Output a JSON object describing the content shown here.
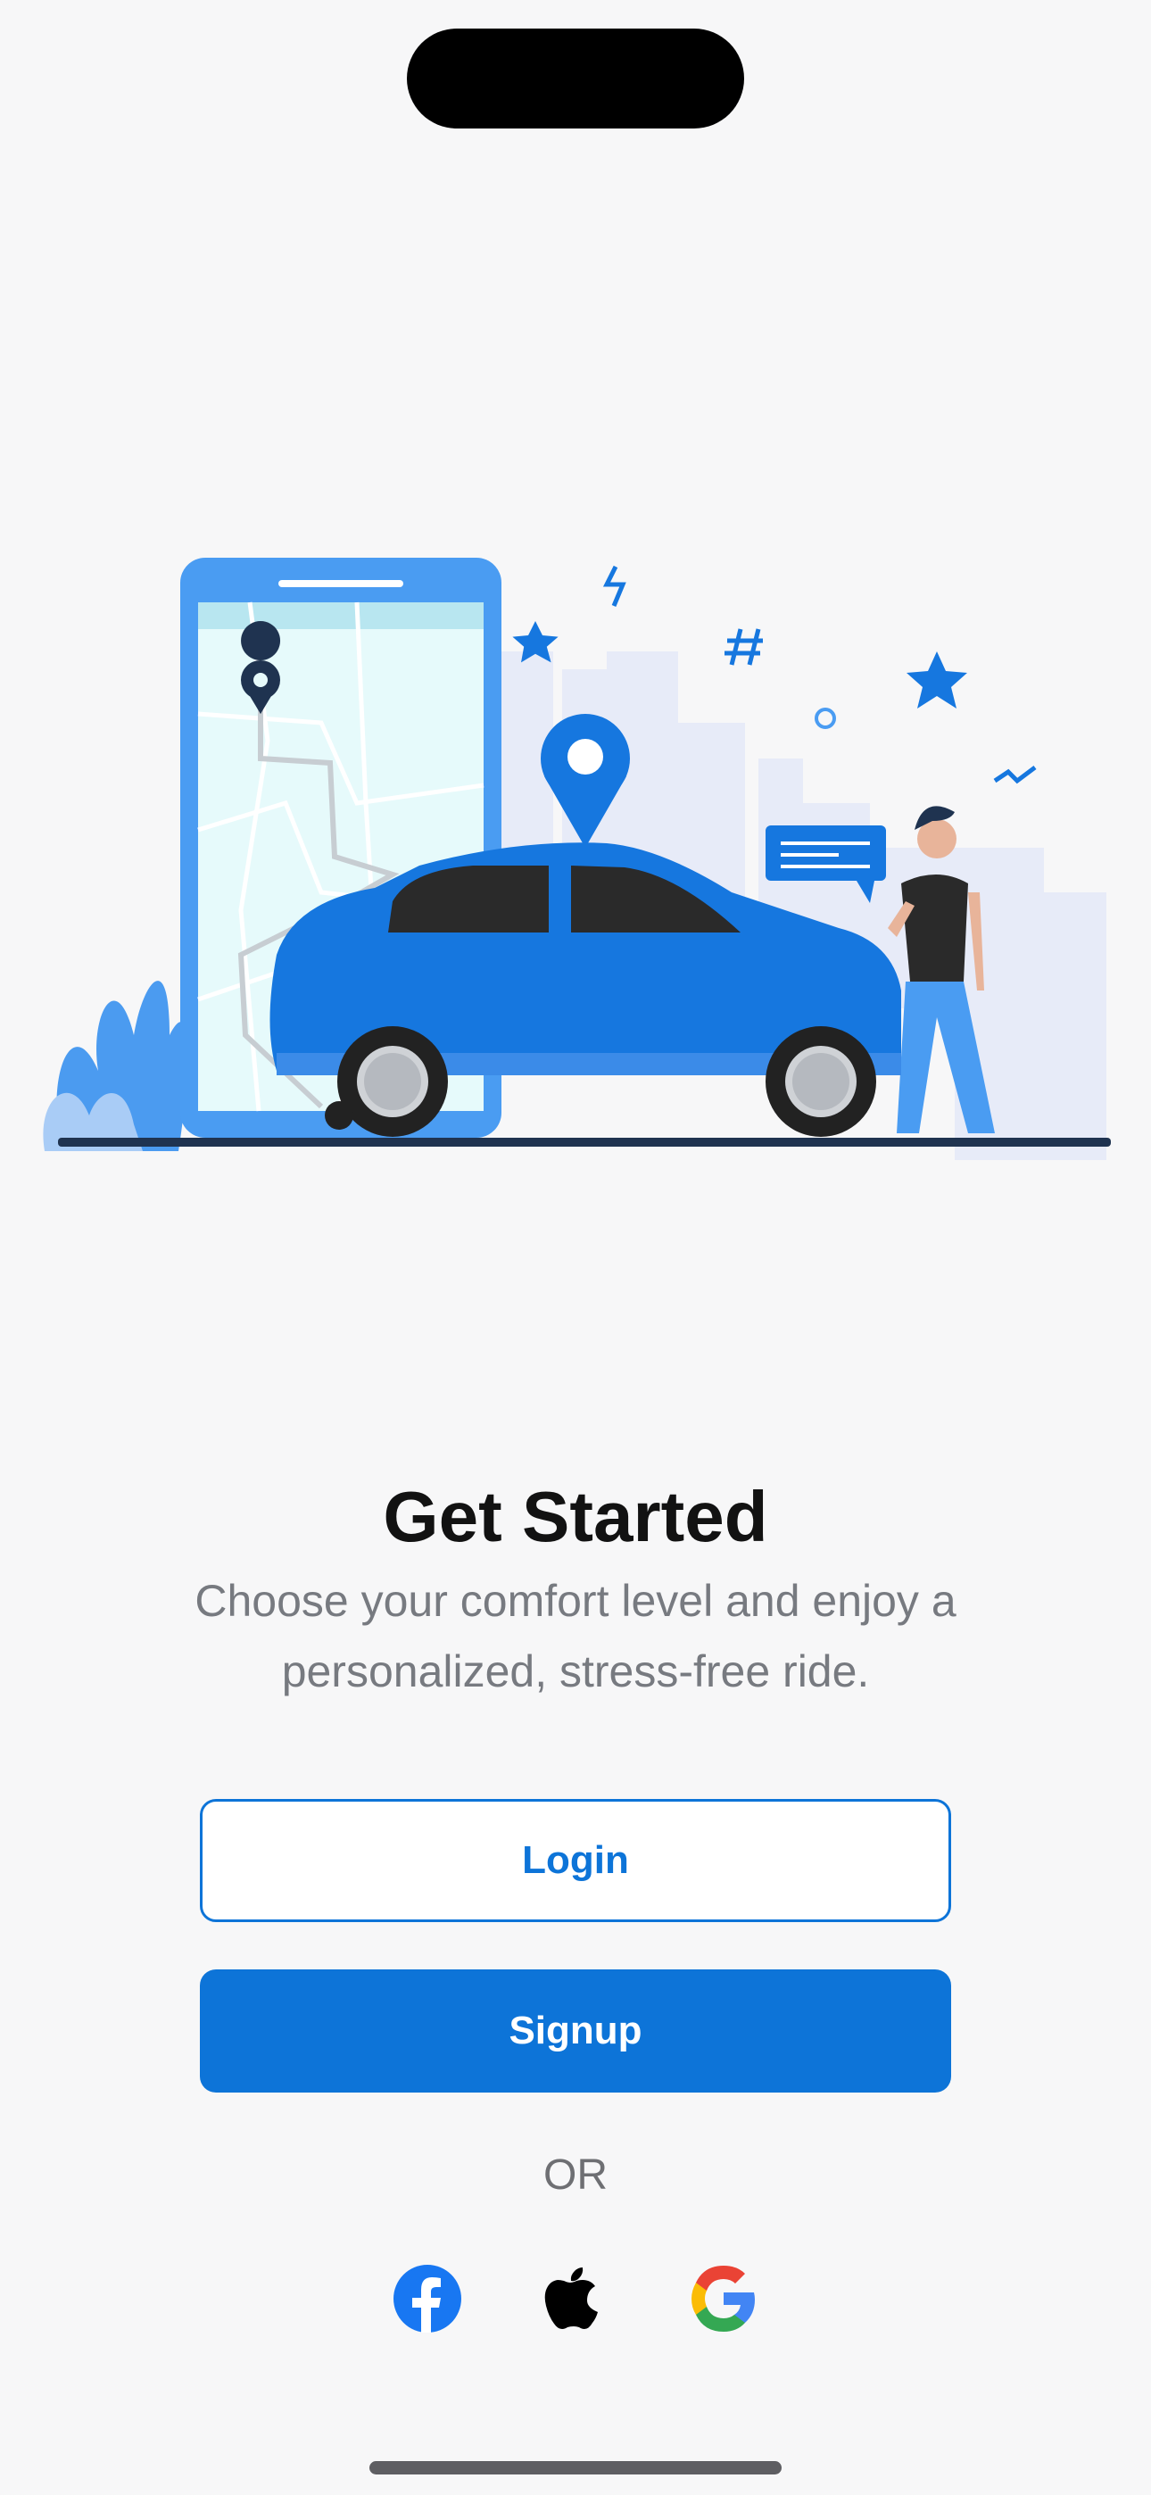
{
  "onboarding": {
    "title": "Get Started",
    "subtitle": "Choose your comfort level and enjoy a personalized, stress-free ride.",
    "login_label": "Login",
    "signup_label": "Signup",
    "or_label": "OR"
  },
  "social": [
    {
      "icon": "facebook-icon"
    },
    {
      "icon": "apple-icon"
    },
    {
      "icon": "google-icon"
    }
  ],
  "illustration": {
    "icon": "ride-hailing-illustration"
  },
  "colors": {
    "primary": "#0D74D8",
    "title": "#121212",
    "subtitle": "#777A80",
    "background": "#F7F7F8",
    "facebook": "#1877F2"
  }
}
